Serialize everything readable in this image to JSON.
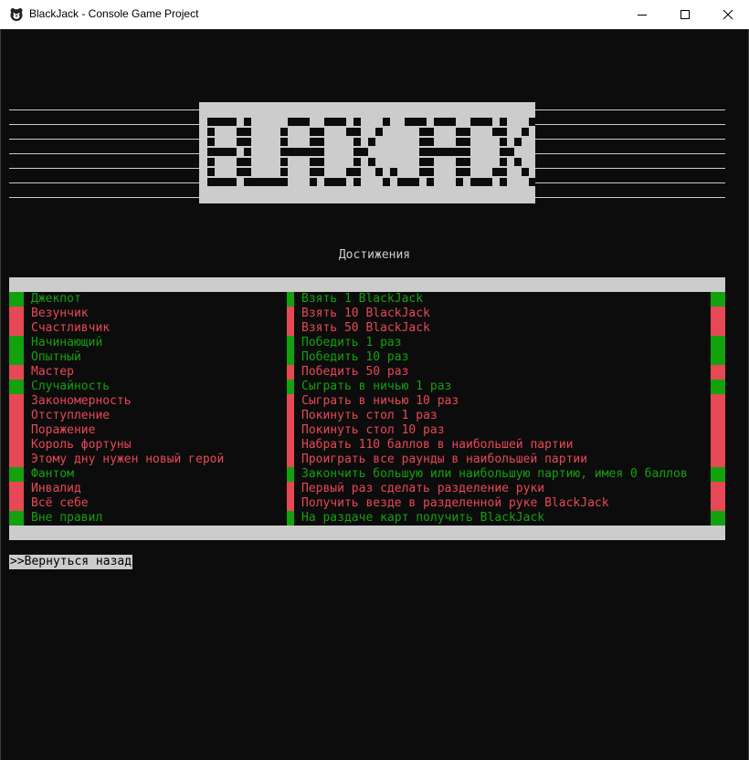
{
  "window": {
    "title": "BlackJack - Console Game Project",
    "icon": "bear-icon"
  },
  "colors": {
    "background": "#0c0c0c",
    "panel": "#cccccc",
    "unlocked": "#13a10e",
    "locked": "#e74856"
  },
  "logo": {
    "text": "BLACKJACK"
  },
  "section_title": "Достижения",
  "achievements": [
    {
      "name": "Джекпот",
      "desc": "Взять 1 BlackJack",
      "status": "unlocked"
    },
    {
      "name": "Везунчик",
      "desc": "Взять 10 BlackJack",
      "status": "locked"
    },
    {
      "name": "Счастливчик",
      "desc": "Взять 50 BlackJack",
      "status": "locked"
    },
    {
      "name": "Начинающий",
      "desc": "Победить 1 раз",
      "status": "unlocked"
    },
    {
      "name": "Опытный",
      "desc": "Победить 10 раз",
      "status": "unlocked"
    },
    {
      "name": "Мастер",
      "desc": "Победить 50 раз",
      "status": "locked"
    },
    {
      "name": "Случайность",
      "desc": "Сыграть в ничью 1 раз",
      "status": "unlocked"
    },
    {
      "name": "Закономерность",
      "desc": "Сыграть в ничью 10 раз",
      "status": "locked"
    },
    {
      "name": "Отступление",
      "desc": "Покинуть стол 1 раз",
      "status": "locked"
    },
    {
      "name": "Поражение",
      "desc": "Покинуть стол 10 раз",
      "status": "locked"
    },
    {
      "name": "Король фортуны",
      "desc": "Набрать 110 баллов в наибольшей партии",
      "status": "locked"
    },
    {
      "name": "Этому дну нужен новый герой",
      "desc": "Проиграть все раунды в наибольшей партии",
      "status": "locked"
    },
    {
      "name": "Фантом",
      "desc": "Закончить большую или наибольшую партию, имея 0 баллов",
      "status": "unlocked"
    },
    {
      "name": "Инвалид",
      "desc": "Первый раз сделать разделение руки",
      "status": "locked"
    },
    {
      "name": "Всё себе",
      "desc": "Получить везде в разделенной руке BlackJack",
      "status": "locked"
    },
    {
      "name": "Вне правил",
      "desc": "На раздаче карт получить BlackJack",
      "status": "unlocked"
    }
  ],
  "back_option": ">>Вернуться назад"
}
